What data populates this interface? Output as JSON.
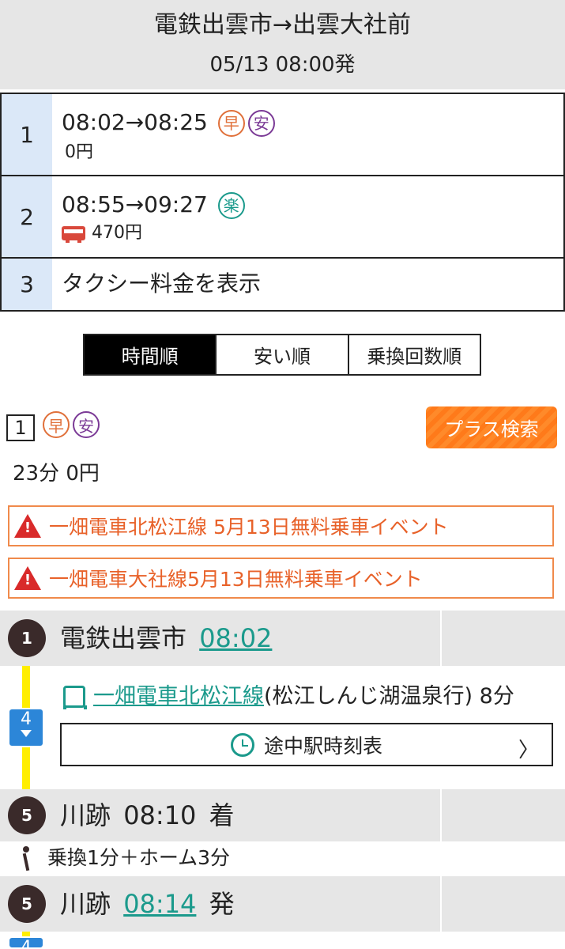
{
  "header": {
    "route": "電鉄出雲市→出雲大社前",
    "datetime": "05/13 08:00発"
  },
  "routes": [
    {
      "num": "1",
      "times": "08:02→08:25",
      "badges": [
        "早",
        "安"
      ],
      "fare": "0円"
    },
    {
      "num": "2",
      "times": "08:55→09:27",
      "badges": [
        "楽"
      ],
      "fare": "470円",
      "icon": "bus-icon"
    },
    {
      "num": "3",
      "label": "タクシー料金を表示"
    }
  ],
  "sort_tabs": [
    {
      "label": "時間順",
      "active": true
    },
    {
      "label": "安い順",
      "active": false
    },
    {
      "label": "乗換回数順",
      "active": false
    }
  ],
  "result": {
    "num": "1",
    "badges": [
      "早",
      "安"
    ],
    "plus_button": "プラス検索",
    "summary": "23分 0円"
  },
  "alerts": [
    "一畑電車北松江線 5月13日無料乗車イベント",
    "一畑電車大社線5月13日無料乗車イベント"
  ],
  "timeline": {
    "stop1": {
      "num": "1",
      "name": "電鉄出雲市",
      "time": "08:02"
    },
    "platform": "4",
    "train": {
      "line": "一畑電車北松江線",
      "dest": "(松江しんじ湖温泉行) 8分"
    },
    "timetable_button": "途中駅時刻表",
    "stop2": {
      "num": "5",
      "name": "川跡",
      "time": "08:10",
      "suffix": "着"
    },
    "transfer": "乗換1分＋ホーム3分",
    "stop3": {
      "num": "5",
      "name": "川跡",
      "time": "08:14",
      "suffix": "発"
    },
    "platform_next": "4"
  },
  "colors": {
    "fast": "#e0703a",
    "cheap": "#7b3a96",
    "easy": "#1b9a8c",
    "link": "#1b9a8c",
    "alert": "#e8622a",
    "line_yellow": "#ffee00",
    "platform_blue": "#2c86d8"
  }
}
